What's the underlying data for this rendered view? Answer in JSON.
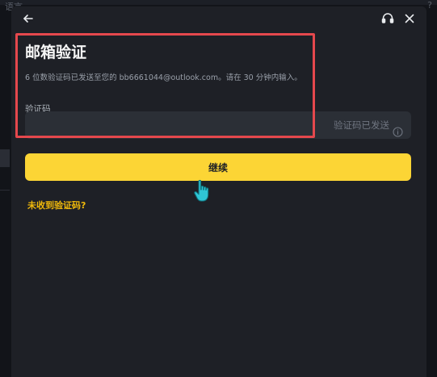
{
  "backdrop": {
    "top_label": "语言",
    "help_glyph": "?"
  },
  "header": {
    "back_icon": "arrow-left-icon",
    "support_icon": "headset-icon",
    "close_icon": "close-icon"
  },
  "title": "邮箱验证",
  "subtitle": "6 位数验证码已发送至您的 bb6661044@outlook.com。请在 30 分钟内输入。",
  "code_field": {
    "label": "验证码",
    "value": "",
    "status_text": "验证码已发送",
    "status_icon": "info-circle-icon"
  },
  "continue_label": "继续",
  "resend_label": "未收到验证码?",
  "colors": {
    "modal_bg": "#1e2026",
    "input_bg": "#2b2f36",
    "accent_yellow": "#fcd535",
    "link_yellow": "#f0b90b",
    "highlight_red": "#e5484d"
  }
}
